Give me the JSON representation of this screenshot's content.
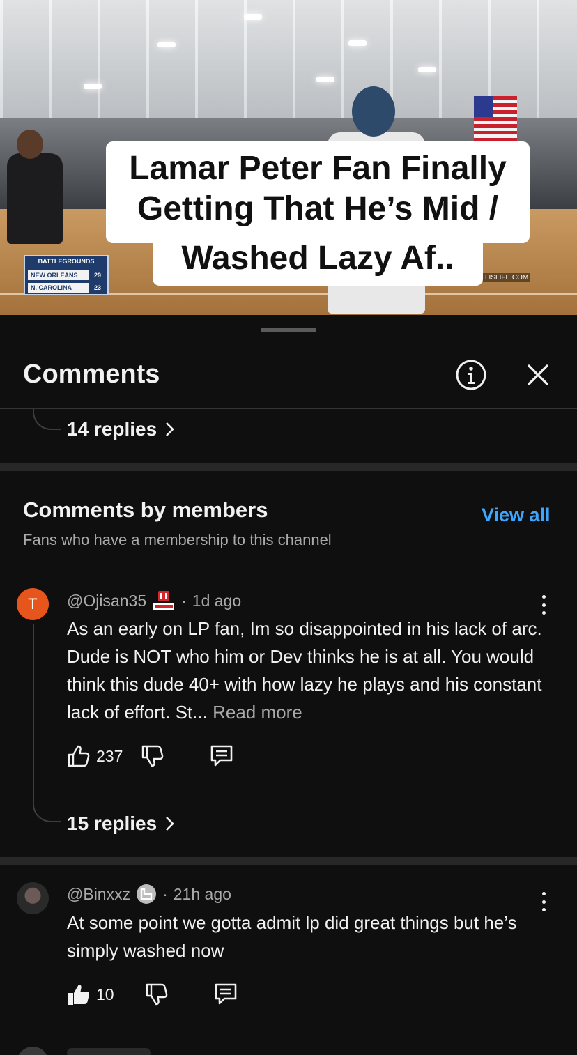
{
  "video": {
    "caption_line1": "Lamar Peter Fan Finally",
    "caption_line2": "Getting That He’s Mid /",
    "caption_line3": "Washed Lazy Af..",
    "scorebug": {
      "header": "BATTLEGROUNDS",
      "team1": "NEW ORLEANS",
      "score1": "29",
      "team2": "N. CAROLINA",
      "score2": "23"
    },
    "watermark": "LISLIFE.COM"
  },
  "sheet": {
    "title": "Comments",
    "info_icon": "info-icon",
    "close_icon": "close-icon"
  },
  "top_thread": {
    "replies_label": "14 replies"
  },
  "members": {
    "title": "Comments by members",
    "subtitle": "Fans who have a membership to this channel",
    "view_all": "View all"
  },
  "comments": [
    {
      "avatar_letter": "T",
      "author": "@Ojisan35",
      "badge": "star-badge-icon",
      "time": "1d ago",
      "text": "As an early on LP fan, Im so disappointed in his lack of arc. Dude is NOT who him or Dev thinks he is at all. You would think this dude 40+ with how lazy he plays and his constant lack of effort. St...",
      "read_more": "Read more",
      "likes": "237",
      "replies_label": "15 replies"
    },
    {
      "author": "@Binxxz",
      "badge": "member-badge-icon",
      "time": "21h ago",
      "text": "At some point we gotta admit lp did great things but he’s simply washed now",
      "likes": "10"
    }
  ],
  "colors": {
    "accent": "#3ea6ff",
    "background": "#0f0f0f",
    "avatar_t": "#e6561c"
  }
}
